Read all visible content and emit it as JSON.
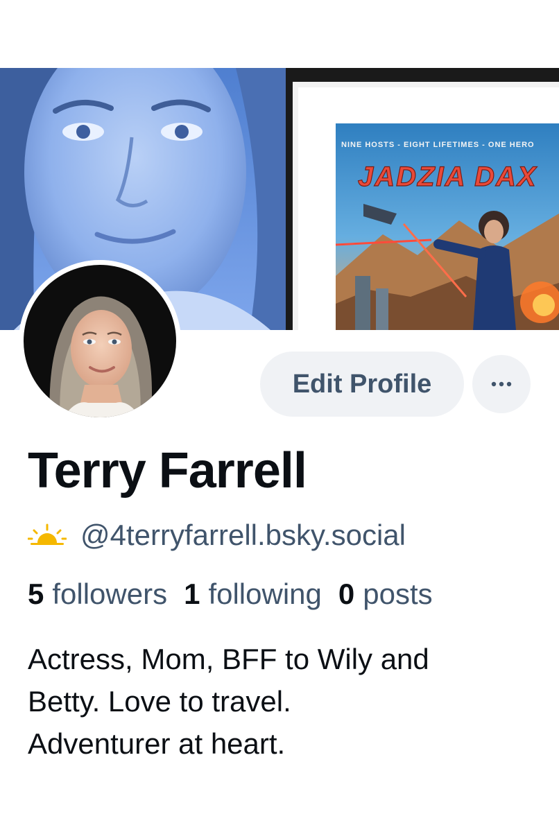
{
  "profile": {
    "display_name": "Terry Farrell",
    "handle": "@4terryfarrell.bsky.social",
    "stats": {
      "followers_count": "5",
      "followers_label": "followers",
      "following_count": "1",
      "following_label": "following",
      "posts_count": "0",
      "posts_label": "posts"
    },
    "bio_lines": [
      "Actress, Mom, BFF to Wily and",
      "Betty. Love to travel.",
      "Adventurer at heart."
    ]
  },
  "actions": {
    "edit_profile_label": "Edit Profile",
    "more_icon": "ellipsis-icon"
  },
  "banner": {
    "poster_tagline": "NINE HOSTS - EIGHT LIFETIMES - ONE HERO",
    "poster_title": "JADZIA DAX"
  },
  "icons": {
    "handle_icon": "sun-icon",
    "more_icon": "ellipsis-icon"
  },
  "colors": {
    "name_text": "#0b0f14",
    "secondary_text": "#40546b",
    "button_bg": "#f0f2f5",
    "sun_icon": "#f5b800",
    "banner_tint": "#6f9be8"
  }
}
